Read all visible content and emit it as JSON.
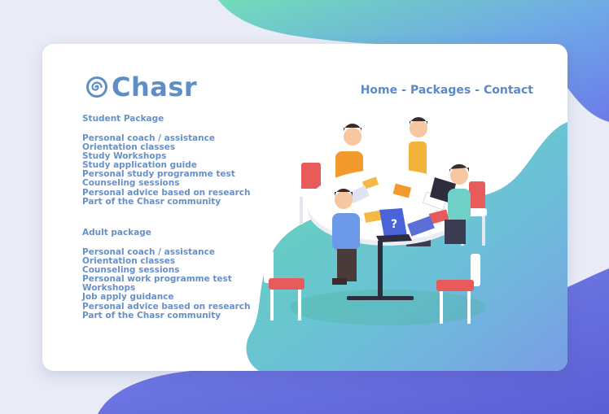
{
  "brand": {
    "name": "Chasr",
    "icon": "spiral-icon"
  },
  "nav": {
    "items": [
      {
        "label": "Home"
      },
      {
        "label": "Packages"
      },
      {
        "label": "Contact"
      }
    ],
    "separator": "-"
  },
  "packages": {
    "student": {
      "title": "Student Package",
      "items": [
        "Personal coach / assistance",
        "Orientation classes",
        "Study Workshops",
        "Study application guide",
        "Personal study programme test",
        "Counseling sessions",
        "Personal advice based on research",
        "Part of the Chasr community"
      ]
    },
    "adult": {
      "title": "Adult package",
      "items": [
        "Personal coach / assistance",
        "Orientation classes",
        "Counseling sessions",
        "Personal work programme test",
        "Workshops",
        "Job apply guidance",
        "Personal advice based on research",
        "Part of the Chasr community"
      ]
    }
  },
  "colors": {
    "accent_blue": "#5f8ec5",
    "teal": "#62d2b6",
    "purple": "#6f6fdc",
    "background": "#e9ecf6"
  },
  "illustration": {
    "icon": "team-meeting-illustration"
  }
}
